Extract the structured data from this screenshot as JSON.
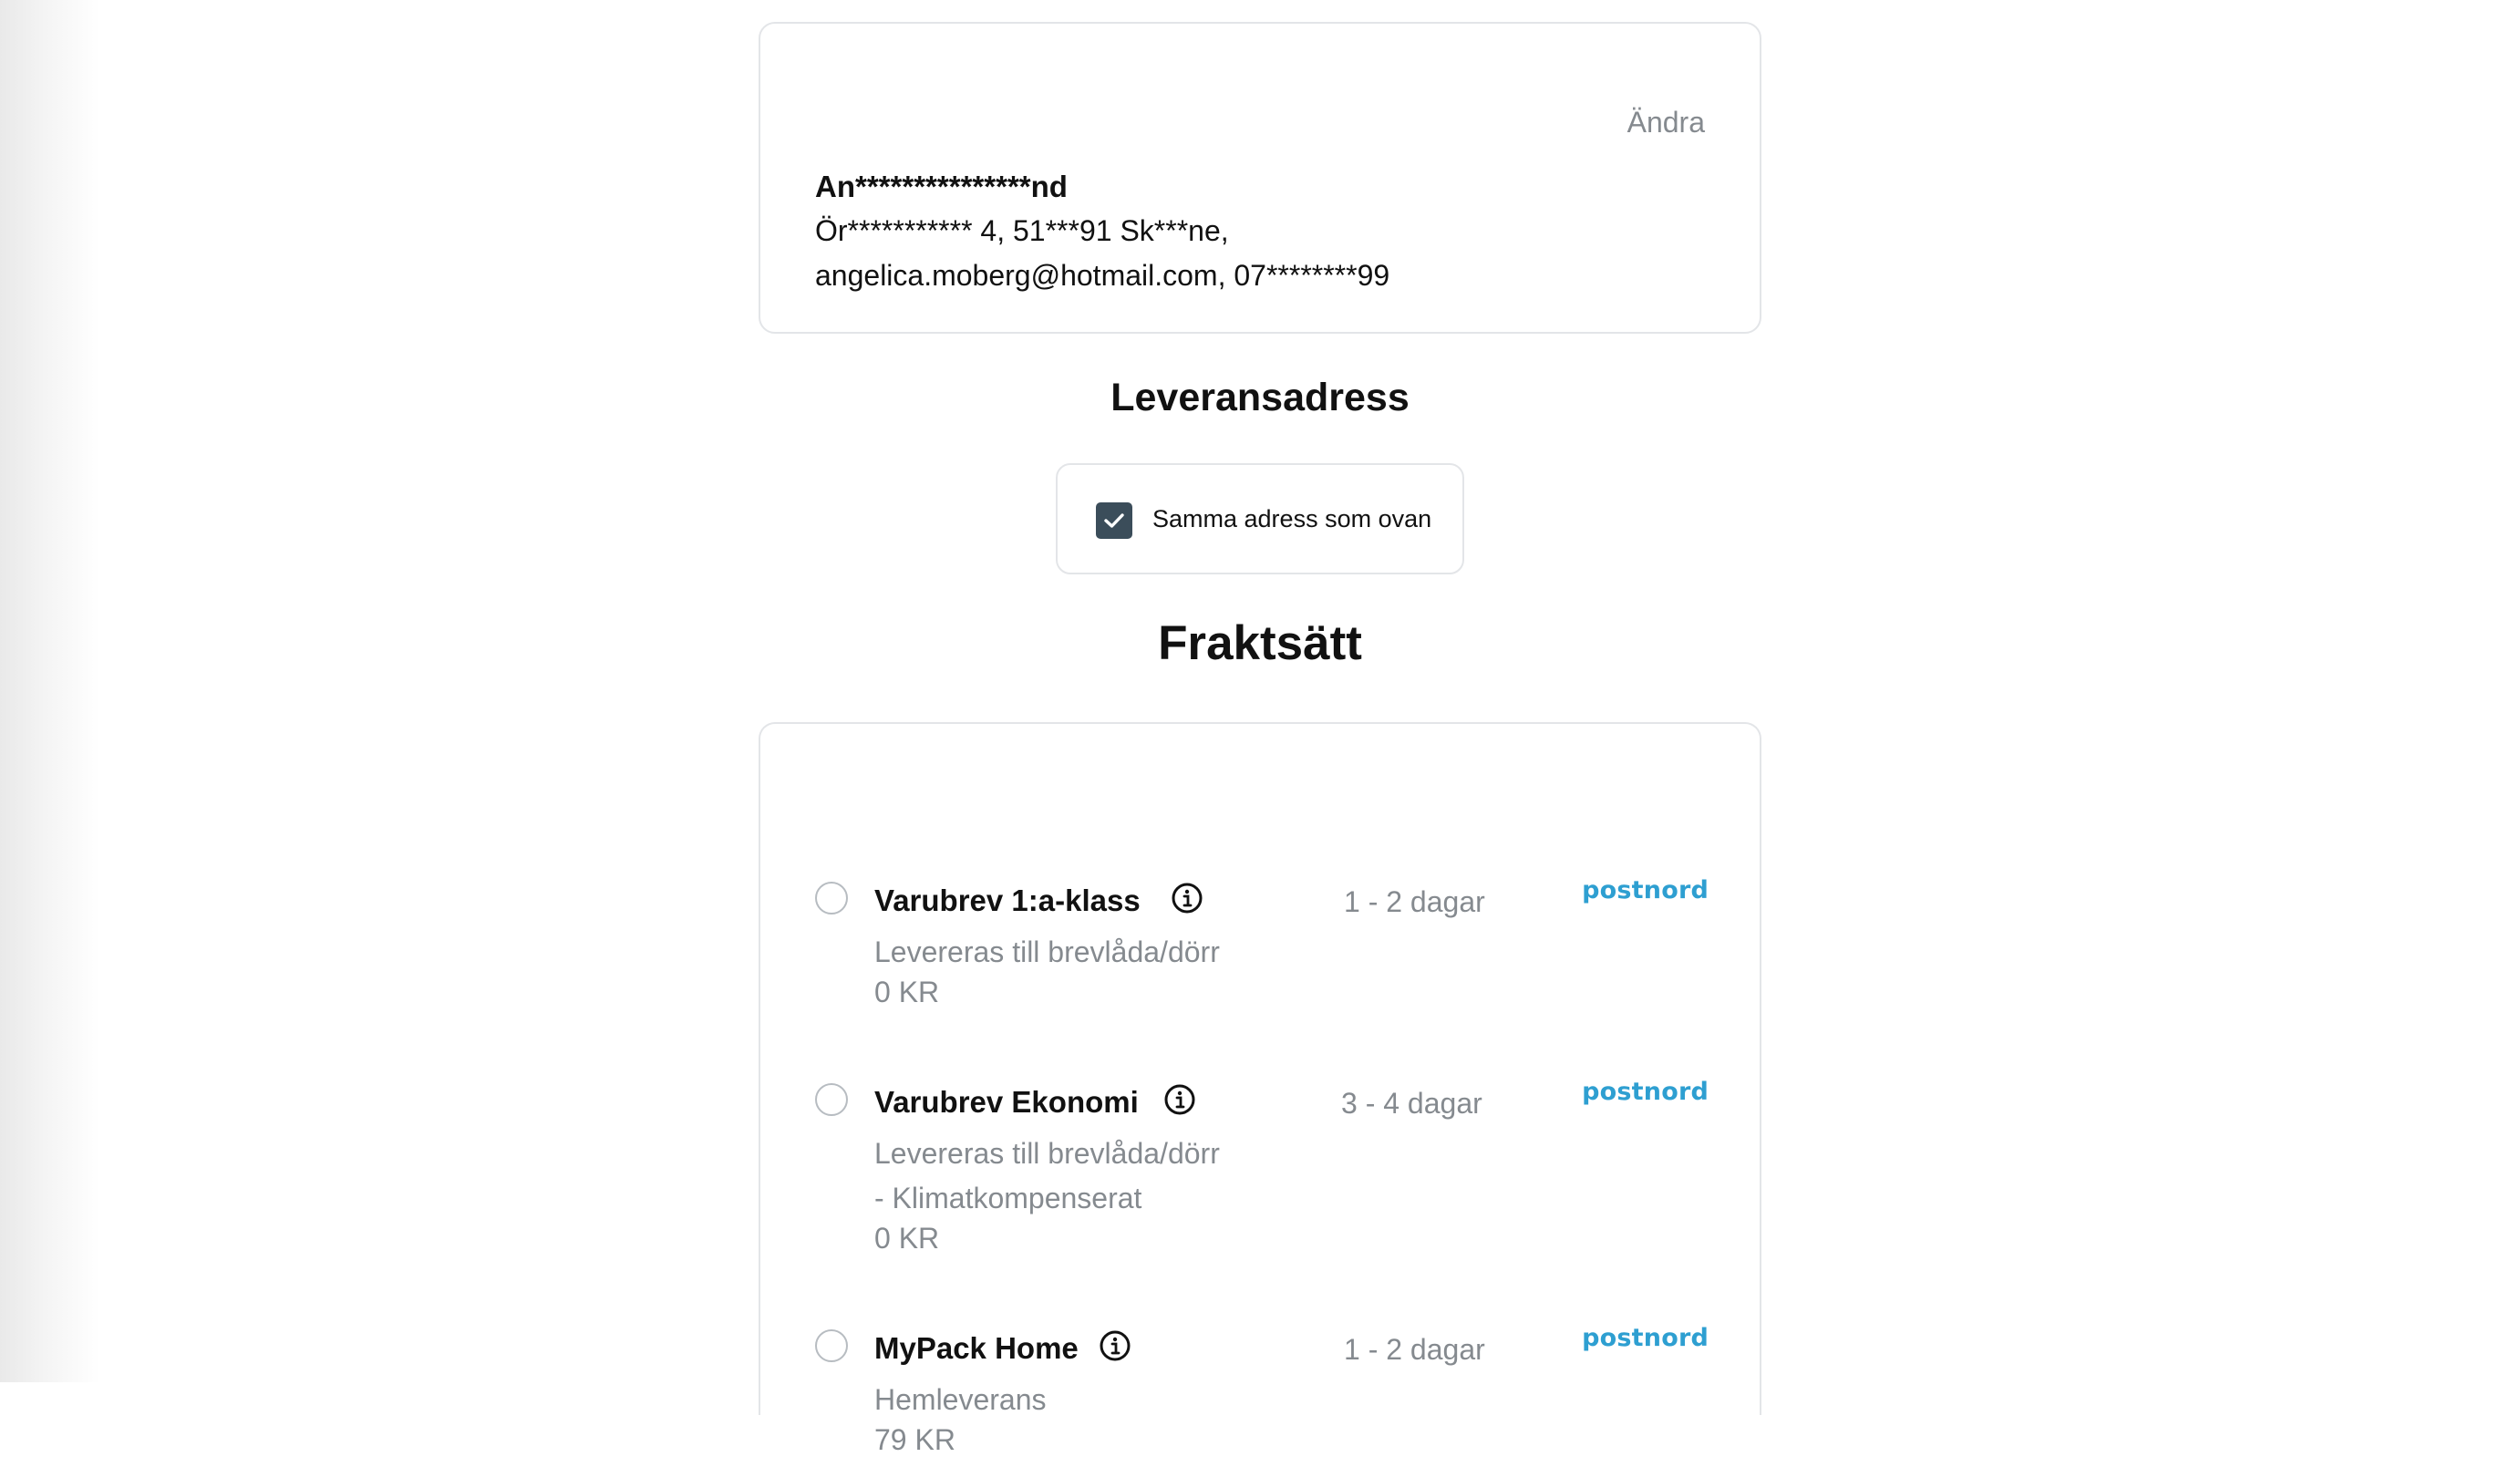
{
  "customer": {
    "change_label": "Ändra",
    "name": "An***************nd",
    "address": "Ör*********** 4, 51***91  Sk***ne,",
    "contact": "angelica.moberg@hotmail.com, 07********99"
  },
  "delivery_address": {
    "title": "Leveransadress",
    "same_address_label": "Samma adress som ovan",
    "same_address_checked": true
  },
  "shipping": {
    "title": "Fraktsätt",
    "options": [
      {
        "name": "Varubrev 1:a-klass",
        "time": "1 - 2 dagar",
        "description": "Levereras till brevlåda/dörr",
        "price": "0 KR",
        "carrier": "postnord",
        "selected": false
      },
      {
        "name": "Varubrev Ekonomi",
        "time": "3 - 4 dagar",
        "description_line1": "Levereras till brevlåda/dörr",
        "description_line2": "- Klimatkompenserat",
        "price": "0 KR",
        "carrier": "postnord",
        "selected": false
      },
      {
        "name": "MyPack Home",
        "time": "1 - 2 dagar",
        "description": "Hemleverans",
        "price": "79 KR",
        "carrier": "postnord",
        "selected": false
      }
    ]
  },
  "icons": {
    "checkbox": "check-icon",
    "info": "info-icon"
  },
  "colors": {
    "checkbox_fill": "#3b4d5a",
    "muted_text": "#858a8f",
    "carrier_brand": "#2e9fd1",
    "border": "#e3e5e8"
  }
}
